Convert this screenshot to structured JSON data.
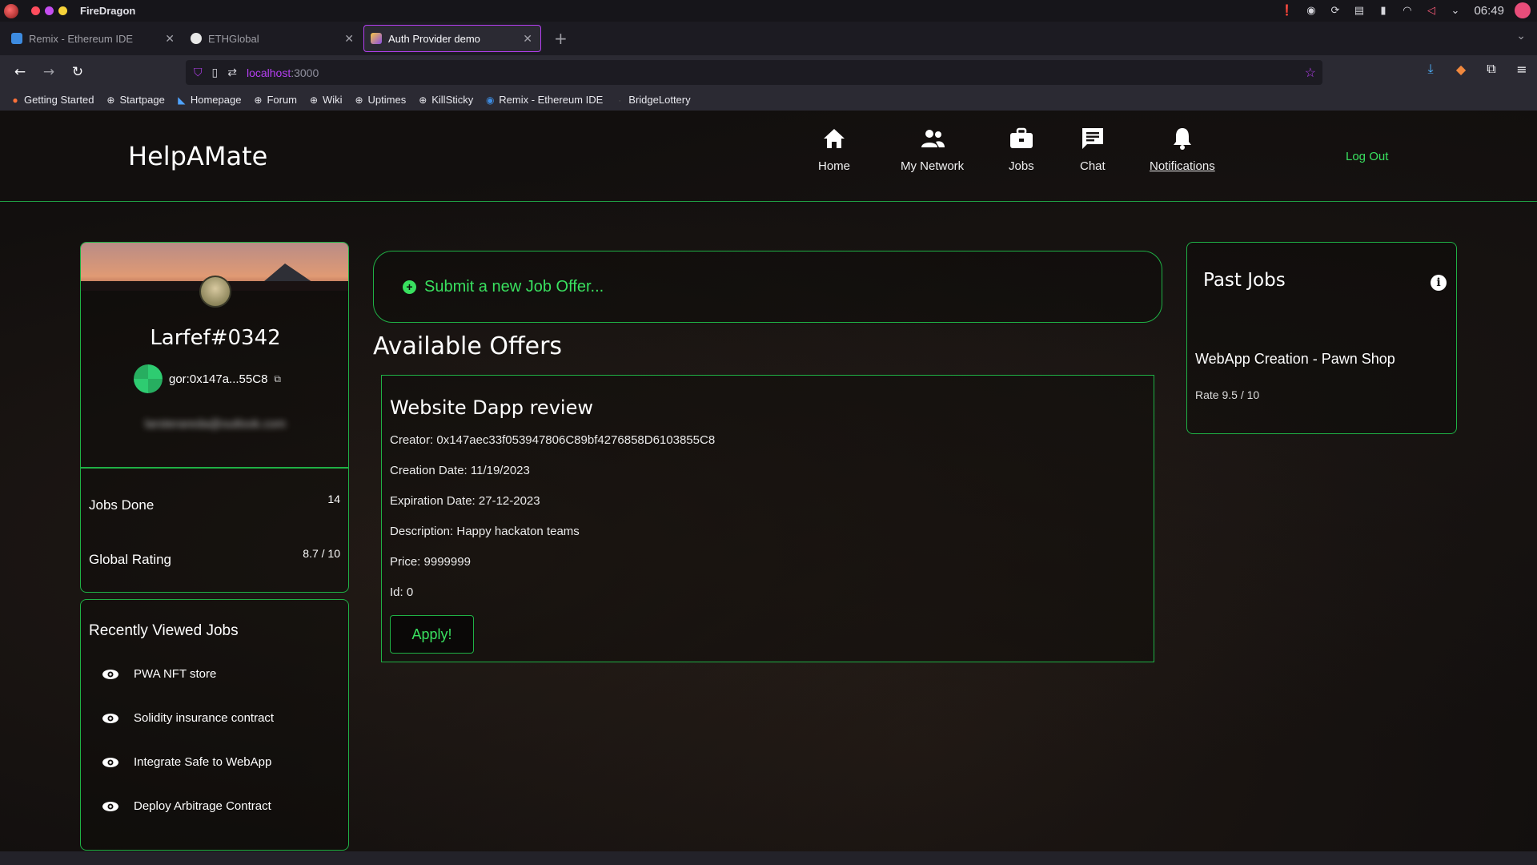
{
  "system": {
    "app_name": "FireDragon",
    "clock": "06:49"
  },
  "browser": {
    "tabs": [
      {
        "label": "Remix - Ethereum IDE",
        "active": false
      },
      {
        "label": "ETHGlobal",
        "active": false
      },
      {
        "label": "Auth Provider demo",
        "active": true
      }
    ],
    "url_host": "localhost",
    "url_port": ":3000",
    "bookmarks": [
      "Getting Started",
      "Startpage",
      "Homepage",
      "Forum",
      "Wiki",
      "Uptimes",
      "KillSticky",
      "Remix - Ethereum IDE",
      "BridgeLottery"
    ]
  },
  "header": {
    "brand": "HelpAMate",
    "nav": [
      {
        "label": "Home",
        "icon": "home-icon"
      },
      {
        "label": "My Network",
        "icon": "network-icon"
      },
      {
        "label": "Jobs",
        "icon": "briefcase-icon"
      },
      {
        "label": "Chat",
        "icon": "chat-icon"
      },
      {
        "label": "Notifications",
        "icon": "bell-icon"
      }
    ],
    "logout": "Log Out"
  },
  "profile": {
    "name": "Larfef#0342",
    "wallet": "gor:0x147a...55C8",
    "email": "larsterareda@outlook.com"
  },
  "stats": {
    "jobs_done_label": "Jobs Done",
    "jobs_done_value": "14",
    "rating_label": "Global Rating",
    "rating_value": "8.7 / 10"
  },
  "recent": {
    "title": "Recently Viewed Jobs",
    "items": [
      "PWA NFT store",
      "Solidity insurance contract",
      "Integrate Safe to WebApp",
      "Deploy Arbitrage Contract"
    ]
  },
  "main": {
    "submit_label": "Submit a new Job Offer...",
    "available_title": "Available Offers",
    "offer": {
      "title": "Website Dapp review",
      "creator": "Creator: 0x147aec33f053947806C89bf4276858D6103855C8",
      "creation_date": "Creation Date: 11/19/2023",
      "expiration_date": "Expiration Date: 27-12-2023",
      "description": "Description: Happy hackaton teams",
      "price": "Price: 9999999",
      "id": "Id: 0",
      "apply_label": "Apply!"
    }
  },
  "past_jobs": {
    "title": "Past Jobs",
    "info_icon": "i",
    "job_title": "WebApp Creation - Pawn Shop",
    "rate": "Rate 9.5 / 10"
  },
  "colors": {
    "accent": "#39e05f",
    "border": "#1fb045",
    "browser_accent": "#b53ff2"
  }
}
